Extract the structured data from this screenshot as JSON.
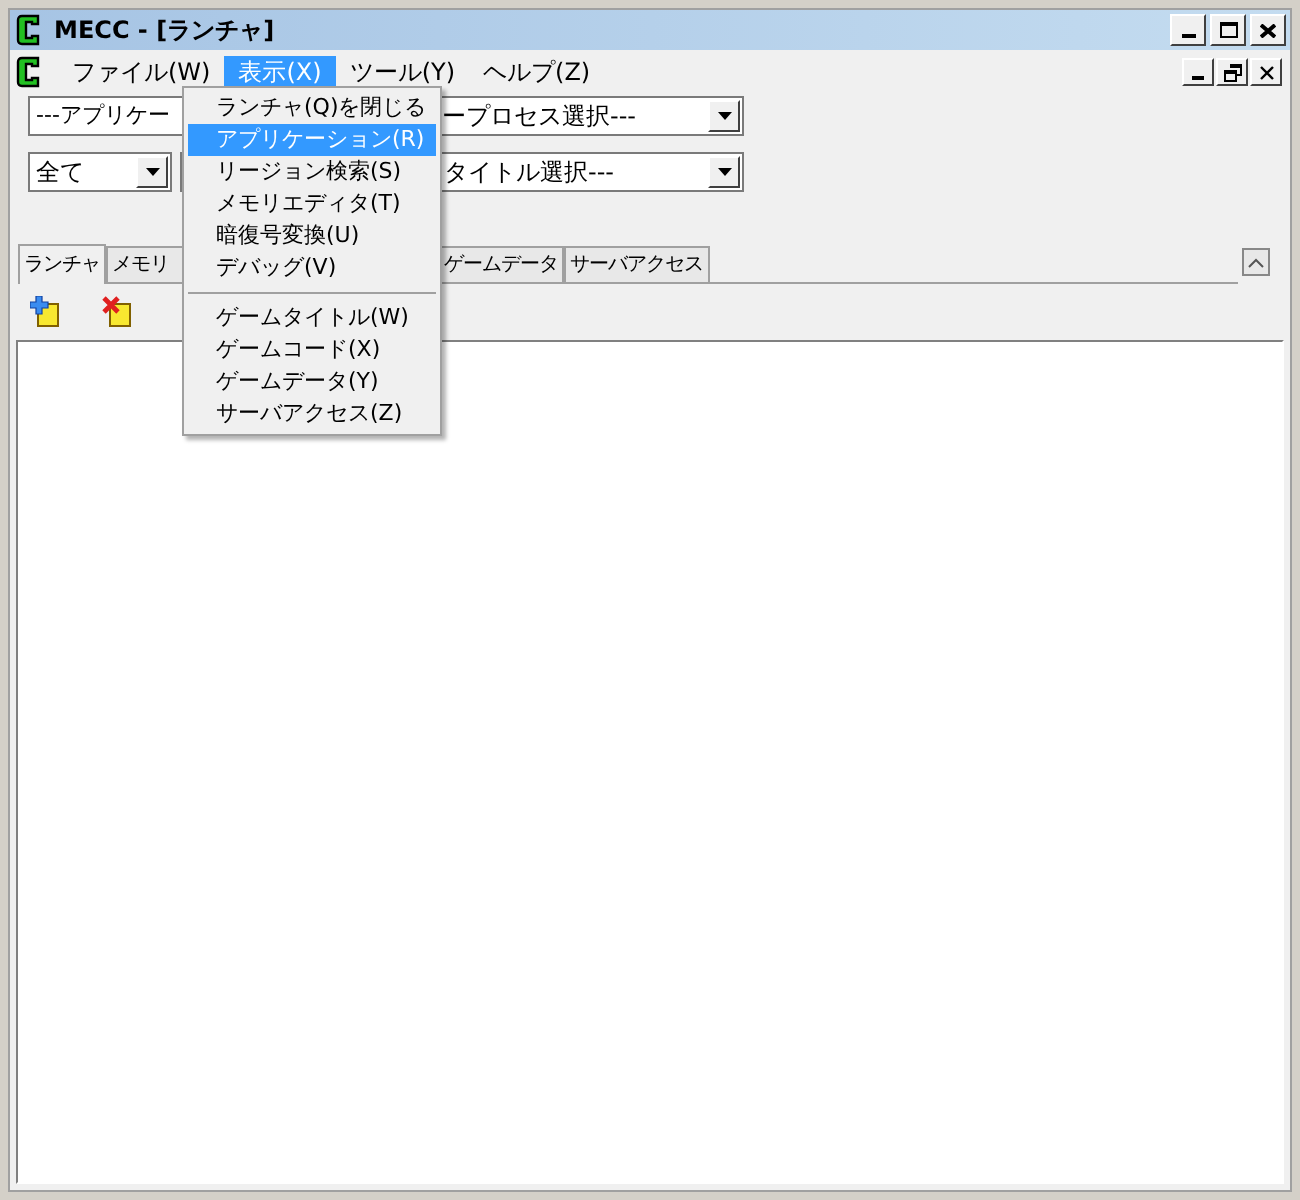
{
  "window": {
    "title": "MECC - [ランチャ]"
  },
  "menu_bar": [
    {
      "label": "ファイル(W)",
      "selected": false
    },
    {
      "label": "表示(X)",
      "selected": true
    },
    {
      "label": "ツール(Y)",
      "selected": false
    },
    {
      "label": "ヘルプ(Z)",
      "selected": false
    }
  ],
  "open_menu": {
    "items": [
      {
        "kind": "item",
        "label": "ランチャ(Q)を閉じる",
        "selected": false
      },
      {
        "kind": "item",
        "label": "アプリケーション(R)",
        "selected": true
      },
      {
        "kind": "item",
        "label": "リージョン検索(S)",
        "selected": false
      },
      {
        "kind": "item",
        "label": "メモリエディタ(T)",
        "selected": false
      },
      {
        "kind": "item",
        "label": "暗復号変換(U)",
        "selected": false
      },
      {
        "kind": "item",
        "label": "デバッグ(V)",
        "selected": false
      },
      {
        "kind": "separator"
      },
      {
        "kind": "item",
        "label": "ゲームタイトル(W)",
        "selected": false
      },
      {
        "kind": "item",
        "label": "ゲームコード(X)",
        "selected": false
      },
      {
        "kind": "item",
        "label": "ゲームデータ(Y)",
        "selected": false
      },
      {
        "kind": "item",
        "label": "サーバアクセス(Z)",
        "selected": false
      }
    ]
  },
  "process_combo": {
    "text_parts": [
      "---アプリケー",
      "ープロセス選択---"
    ]
  },
  "filter_combo": {
    "value": "全て"
  },
  "title_combo": {
    "text": "タイトル選択---"
  },
  "tabs": [
    {
      "label": "ランチャ",
      "selected": true
    },
    {
      "label": "メモリ",
      "selected": false
    },
    {
      "label": "ゲームデータ",
      "selected": false
    },
    {
      "label": "サーバアクセス",
      "selected": false
    }
  ]
}
